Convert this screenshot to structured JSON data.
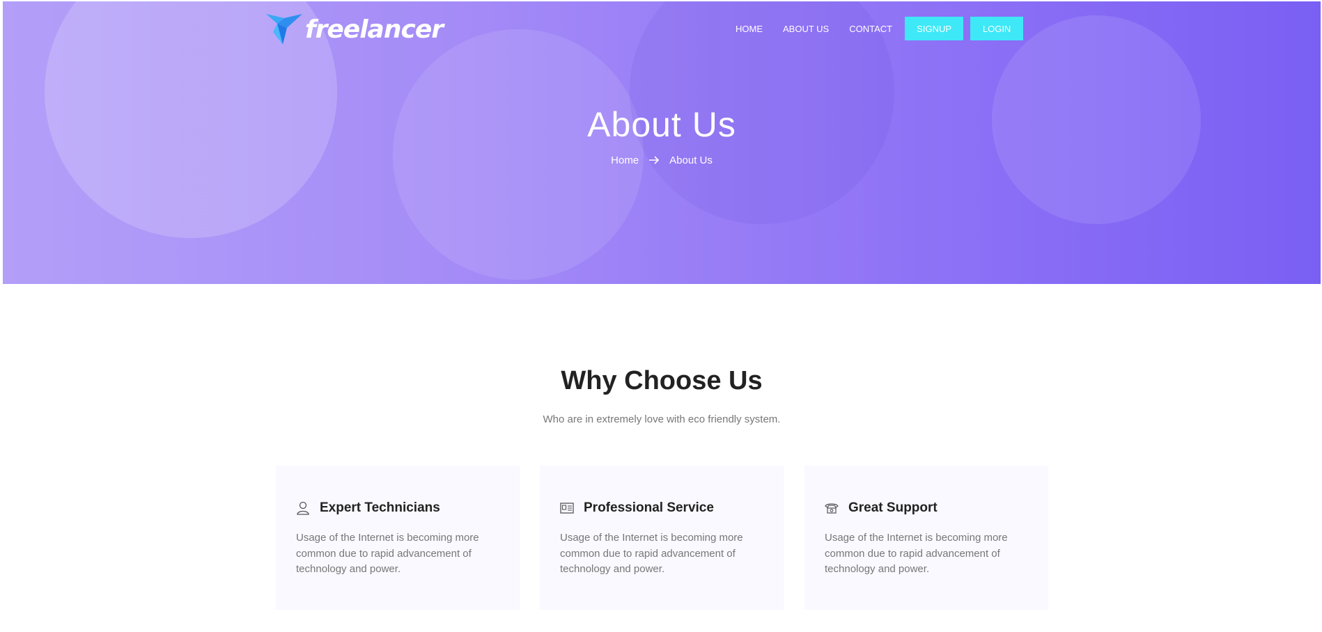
{
  "brand": {
    "logo_text": "freelancer",
    "accent_color": "#3ee8f7",
    "hero_gradient": [
      "#b39ff8",
      "#7a5ff4"
    ]
  },
  "nav": {
    "home": "HOME",
    "about": "ABOUT US",
    "contact": "CONTACT",
    "signup": "SIGNUP",
    "login": "LOGIN"
  },
  "hero": {
    "title": "About Us",
    "breadcrumb": {
      "home": "Home",
      "separator_icon": "arrow-right-icon",
      "current": "About Us"
    }
  },
  "why": {
    "title": "Why Choose Us",
    "subtitle": "Who are in extremely love with eco friendly system.",
    "cards": [
      {
        "icon": "user-icon",
        "title": "Expert Technicians",
        "text": "Usage of the Internet is becoming more common due to rapid advancement of technology and power."
      },
      {
        "icon": "license-icon",
        "title": "Professional Service",
        "text": "Usage of the Internet is becoming more common due to rapid advancement of technology and power."
      },
      {
        "icon": "phone-icon",
        "title": "Great Support",
        "text": "Usage of the Internet is becoming more common due to rapid advancement of technology and power."
      }
    ]
  }
}
